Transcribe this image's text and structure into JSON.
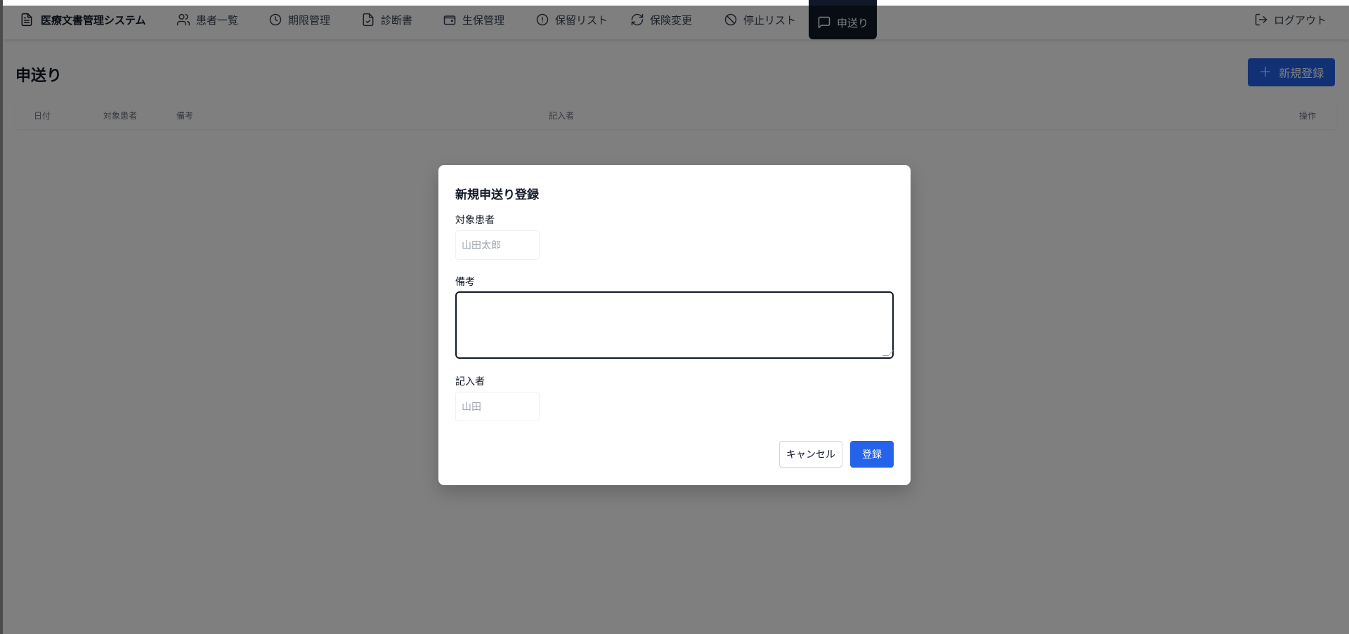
{
  "nav": {
    "brand": "医療文書管理システム",
    "items": [
      {
        "label": "患者一覧",
        "icon": "users-icon"
      },
      {
        "label": "期限管理",
        "icon": "clock-icon"
      },
      {
        "label": "診断書",
        "icon": "file-check-icon"
      },
      {
        "label": "生保管理",
        "icon": "wallet-icon"
      },
      {
        "label": "保留リスト",
        "icon": "alert-circle-icon"
      },
      {
        "label": "保険変更",
        "icon": "refresh-icon"
      },
      {
        "label": "停止リスト",
        "icon": "ban-icon"
      },
      {
        "label": "申送り",
        "icon": "message-square-icon",
        "active": true
      }
    ],
    "logout": "ログアウト"
  },
  "page": {
    "title": "申送り",
    "new_button": "新規登録",
    "columns": [
      "日付",
      "対象患者",
      "備考",
      "記入者",
      "操作"
    ]
  },
  "modal": {
    "title": "新規申送り登録",
    "patient_label": "対象患者",
    "patient_placeholder": "山田太郎",
    "note_label": "備考",
    "note_value": "",
    "writer_label": "記入者",
    "writer_placeholder": "山田",
    "cancel": "キャンセル",
    "submit": "登録"
  },
  "colors": {
    "accent": "#2563eb",
    "active_nav": "#111827",
    "overlay": "rgba(0,0,0,0.5)"
  }
}
